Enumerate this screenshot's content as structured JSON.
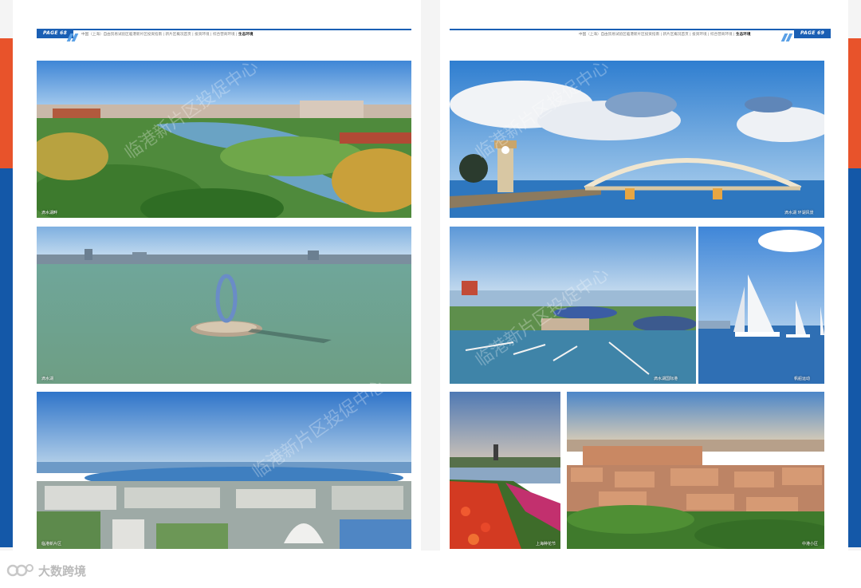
{
  "left_page": {
    "tab": "PAGE 68",
    "breadcrumb": "中国（上海）自由贸易试验区临港新片区投资指南 | 新片区概况首页 | 投资环境 | 综合营商环境 |",
    "breadcrumb_active": "生态环境",
    "captions": [
      "滴水湖畔",
      "滴水湖",
      "临港新片区"
    ]
  },
  "right_page": {
    "tab": "PAGE 69",
    "breadcrumb": "中国（上海）自由贸易试验区临港新片区投资指南 | 新片区概况首页 | 投资环境 | 综合营商环境 |",
    "breadcrumb_active": "生态环境",
    "captions": [
      "滴水湖 环湖风景",
      "滴水湖国际港",
      "帆船运动",
      "上海种花节",
      "中港小区"
    ]
  },
  "watermarks": [
    "临港新片区投促中心",
    "临港新片区投促中心",
    "临港新片区投促中心",
    "临港新片区投促中心"
  ],
  "logo": {
    "text": "大数跨境",
    "icon": "dashuju-logo-icon"
  },
  "colors": {
    "brand_blue": "#1a5fb4",
    "accent_orange": "#e8532b",
    "sky": "#4f8ed8",
    "water": "#5d9a88"
  }
}
